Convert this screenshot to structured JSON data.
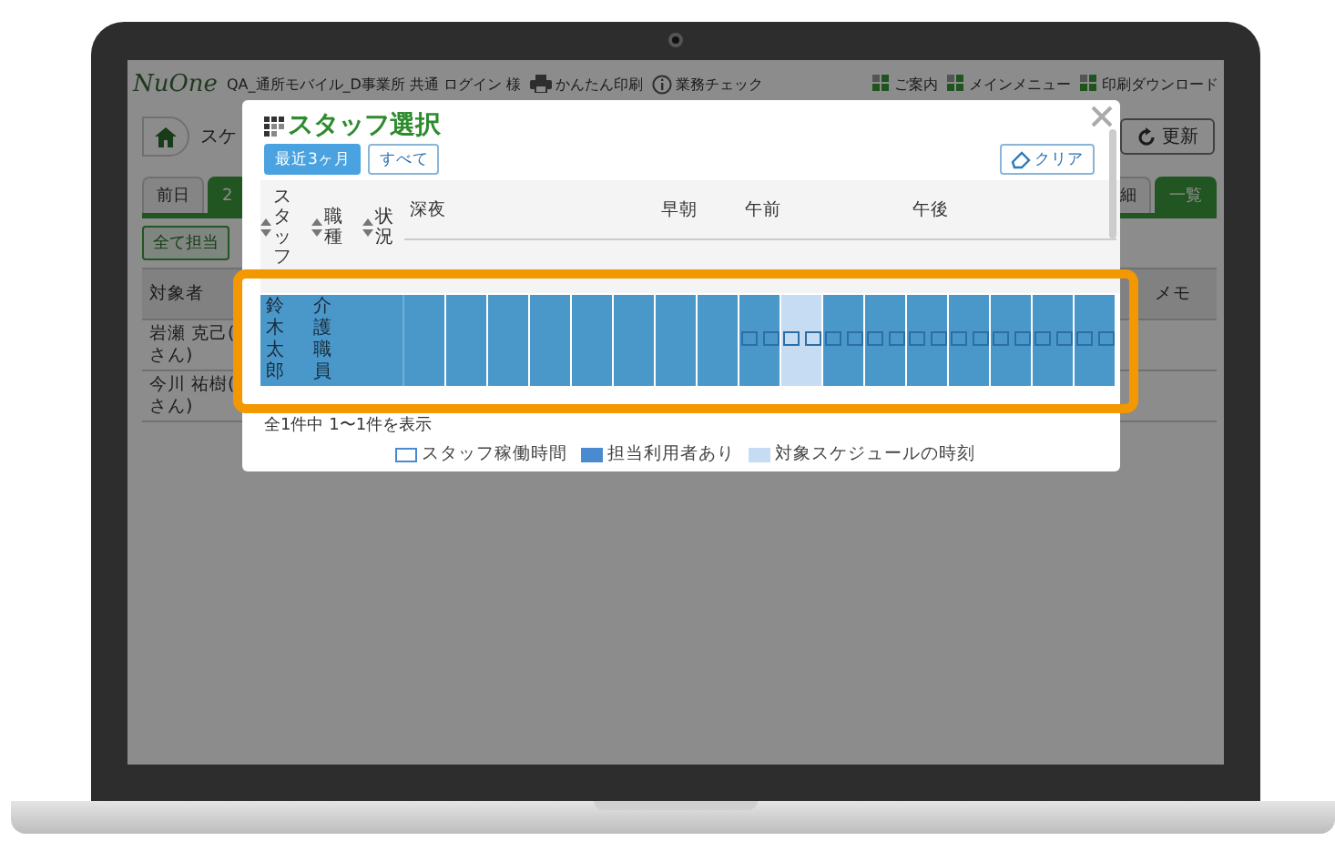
{
  "header": {
    "logo": "NuOne",
    "account": "QA_通所モバイル_D事業所 共通 ログイン 様",
    "links": [
      {
        "kind": "print",
        "label": "かんたん印刷"
      },
      {
        "kind": "info",
        "label": "業務チェック"
      }
    ],
    "menus": [
      "ご案内",
      "メインメニュー",
      "印刷ダウンロード"
    ]
  },
  "toolbar": {
    "page_title": "スケ",
    "refresh": "更新"
  },
  "tabs_left": [
    {
      "label": "前日",
      "selected": false
    },
    {
      "label": "2",
      "selected": true
    }
  ],
  "tabs_right": [
    {
      "label": "細",
      "selected": false
    },
    {
      "label": "一覧",
      "selected": true
    }
  ],
  "assign_all": "全て担当",
  "table": {
    "columns": [
      "対象者",
      "メモ"
    ],
    "rows": [
      {
        "name_lines": [
          "岩瀬 克己(",
          "さん)"
        ]
      },
      {
        "name_lines": [
          "今川 祐樹(",
          "さん)"
        ]
      }
    ]
  },
  "modal": {
    "title": "スタッフ選択",
    "filters": [
      {
        "label": "最近3ヶ月",
        "selected": true
      },
      {
        "label": "すべて",
        "selected": false
      }
    ],
    "clear": "クリア",
    "columns": [
      "スタッフ",
      "職種",
      "状況"
    ],
    "periods": [
      {
        "label": "深夜"
      },
      {
        "label": "早朝"
      },
      {
        "label": "午前"
      },
      {
        "label": "午後"
      }
    ],
    "rows": [
      {
        "name": "鈴木太郎",
        "job": "介護職員",
        "slot_groups": [
          [
            {
              "working": false,
              "target": false
            },
            {
              "working": false,
              "target": false
            },
            {
              "working": false,
              "target": false
            },
            {
              "working": false,
              "target": false
            },
            {
              "working": false,
              "target": false
            },
            {
              "working": false,
              "target": false
            },
            {
              "working": false,
              "target": false
            },
            {
              "working": false,
              "target": false
            },
            {
              "working": false,
              "target": false
            },
            {
              "working": false,
              "target": false
            },
            {
              "working": false,
              "target": false
            },
            {
              "working": false,
              "target": false
            }
          ],
          [
            {
              "working": false,
              "target": false
            },
            {
              "working": false,
              "target": false
            },
            {
              "working": false,
              "target": false
            },
            {
              "working": false,
              "target": false
            }
          ],
          [
            {
              "working": true,
              "target": false
            },
            {
              "working": true,
              "target": false
            },
            {
              "working": true,
              "target": true
            },
            {
              "working": true,
              "target": true
            },
            {
              "working": true,
              "target": false
            },
            {
              "working": true,
              "target": false
            },
            {
              "working": true,
              "target": false
            },
            {
              "working": true,
              "target": false
            }
          ],
          [
            {
              "working": true,
              "target": false
            },
            {
              "working": true,
              "target": false
            },
            {
              "working": true,
              "target": false
            },
            {
              "working": true,
              "target": false
            },
            {
              "working": true,
              "target": false
            },
            {
              "working": true,
              "target": false
            },
            {
              "working": true,
              "target": false
            },
            {
              "working": true,
              "target": false
            },
            {
              "working": true,
              "target": false
            },
            {
              "working": true,
              "target": false
            }
          ]
        ]
      }
    ],
    "summary": "全1件中 1〜1件を表示",
    "legend": [
      {
        "kind": "working",
        "label": "スタッフ稼働時間"
      },
      {
        "kind": "assigned",
        "label": "担当利用者あり"
      },
      {
        "kind": "target",
        "label": "対象スケジュールの時刻"
      }
    ]
  }
}
